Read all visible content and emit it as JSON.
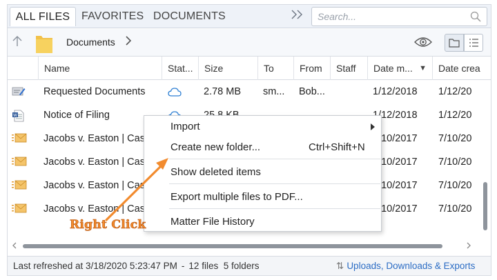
{
  "tabs": [
    "ALL FILES",
    "FAVORITES",
    "DOCUMENTS"
  ],
  "search": {
    "placeholder": "Search..."
  },
  "breadcrumb": {
    "current": "Documents"
  },
  "columns": [
    "Name",
    "Stat...",
    "Size",
    "To",
    "From",
    "Staff",
    "Date m...",
    "Date crea"
  ],
  "sort_indicator": "▼",
  "rows": [
    {
      "icon": "edit-document-icon",
      "name": "Requested Documents",
      "status": "cloud-icon",
      "size": "2.78 MB",
      "to": "sm...",
      "from": "Bob...",
      "staff": "",
      "modified": "1/12/2018",
      "created": "1/12/20"
    },
    {
      "icon": "word-document-icon",
      "name": "Notice of Filing",
      "status": "cloud-icon",
      "size": "25.8 KB",
      "to": "",
      "from": "",
      "staff": "",
      "modified": "1/12/2018",
      "created": "1/12/20"
    },
    {
      "icon": "email-icon",
      "name": "Jacobs v. Easton | Cas",
      "status": "",
      "size": "",
      "to": "",
      "from": "",
      "staff": "",
      "modified": "7/10/2017",
      "created": "7/10/20"
    },
    {
      "icon": "email-icon",
      "name": "Jacobs v. Easton | Cas",
      "status": "",
      "size": "",
      "to": "",
      "from": "",
      "staff": "",
      "modified": "7/10/2017",
      "created": "7/10/20"
    },
    {
      "icon": "email-icon",
      "name": "Jacobs v. Easton | Cas",
      "status": "",
      "size": "",
      "to": "",
      "from": "",
      "staff": "",
      "modified": "7/10/2017",
      "created": "7/10/20"
    },
    {
      "icon": "email-icon",
      "name": "Jacobs v. Easton | Cas",
      "status": "",
      "size": "",
      "to": "",
      "from": "",
      "staff": "",
      "modified": "7/10/2017",
      "created": "7/10/20"
    }
  ],
  "context_menu": [
    {
      "label": "Import",
      "shortcut": "",
      "submenu": true
    },
    {
      "label": "Create new folder...",
      "shortcut": "Ctrl+Shift+N",
      "submenu": false
    },
    {
      "label": "Show deleted items",
      "shortcut": "",
      "submenu": false
    },
    {
      "label": "Export multiple files to PDF...",
      "shortcut": "",
      "submenu": false
    },
    {
      "label": "Matter File History",
      "shortcut": "",
      "submenu": false
    }
  ],
  "status": {
    "refreshed": "Last refreshed at 3/18/2020 5:23:47 PM",
    "separator": "-",
    "files": "12 files",
    "folders": "5 folders",
    "transfers": "Uploads, Downloads & Exports"
  },
  "annotation": {
    "text": "Right Click",
    "color": "#f28b2e"
  },
  "colors": {
    "accent": "#2b6cc4",
    "tab_bar": "#eef2f8",
    "cloud": "#2d7fd3"
  }
}
